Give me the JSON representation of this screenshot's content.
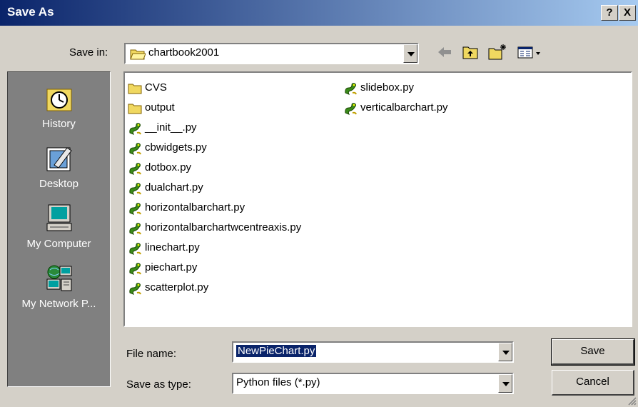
{
  "window": {
    "title": "Save As",
    "help_label": "?",
    "close_label": "X"
  },
  "save_in": {
    "label": "Save in:",
    "value": "chartbook2001"
  },
  "toolbar": {
    "icons": [
      "back-arrow-icon",
      "up-folder-icon",
      "new-folder-icon",
      "view-menu-icon"
    ]
  },
  "places": [
    {
      "label": "History",
      "icon": "history-icon"
    },
    {
      "label": "Desktop",
      "icon": "desktop-icon"
    },
    {
      "label": "My Computer",
      "icon": "my-computer-icon"
    },
    {
      "label": "My Network P...",
      "icon": "network-icon"
    }
  ],
  "files": {
    "column1": [
      {
        "name": "CVS",
        "type": "folder"
      },
      {
        "name": "output",
        "type": "folder"
      },
      {
        "name": "__init__.py",
        "type": "python"
      },
      {
        "name": "cbwidgets.py",
        "type": "python"
      },
      {
        "name": "dotbox.py",
        "type": "python"
      },
      {
        "name": "dualchart.py",
        "type": "python"
      },
      {
        "name": "horizontalbarchart.py",
        "type": "python"
      },
      {
        "name": "horizontalbarchartwcentreaxis.py",
        "type": "python"
      },
      {
        "name": "linechart.py",
        "type": "python"
      },
      {
        "name": "piechart.py",
        "type": "python"
      },
      {
        "name": "scatterplot.py",
        "type": "python"
      }
    ],
    "column2": [
      {
        "name": "slidebox.py",
        "type": "python"
      },
      {
        "name": "verticalbarchart.py",
        "type": "python"
      }
    ]
  },
  "file_name": {
    "label": "File name:",
    "value": "NewPieChart.py"
  },
  "save_as_type": {
    "label": "Save as type:",
    "value": "Python files (*.py)"
  },
  "buttons": {
    "save": "Save",
    "cancel": "Cancel"
  },
  "colors": {
    "titlebar_start": "#0a246a",
    "titlebar_end": "#a6caf0",
    "selection": "#0a246a",
    "face": "#d4d0c8"
  }
}
